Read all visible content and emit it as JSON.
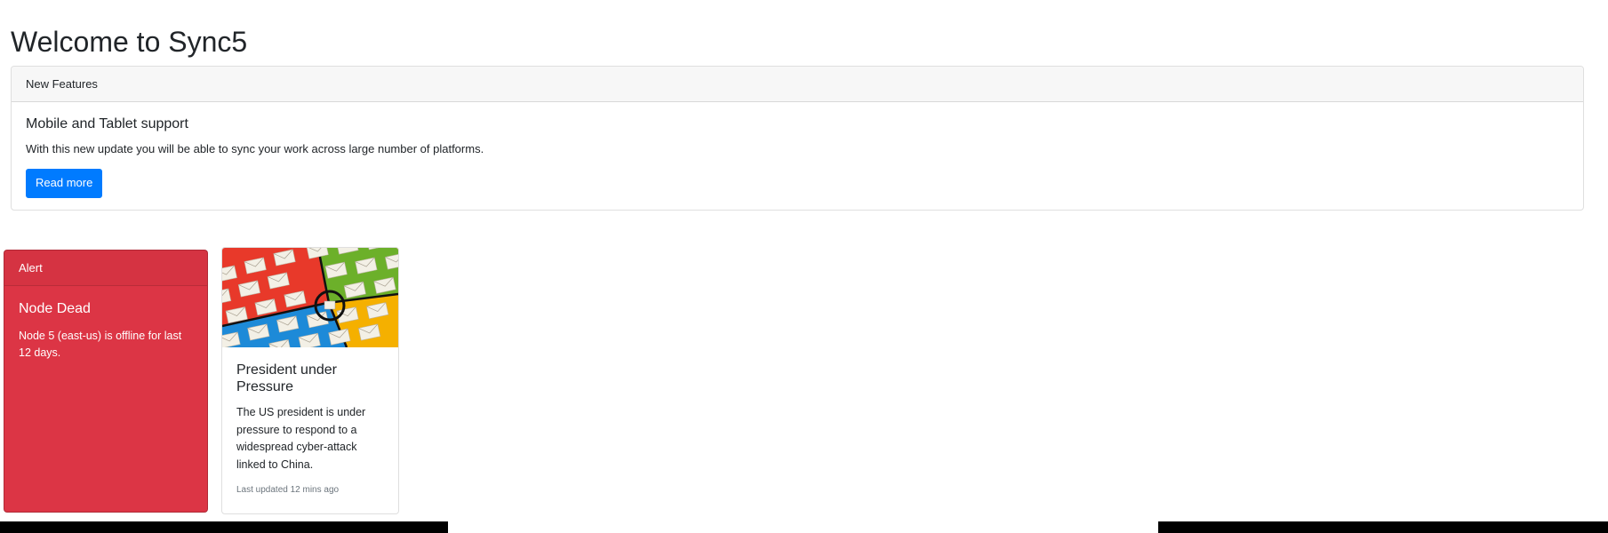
{
  "page": {
    "title": "Welcome to Sync5"
  },
  "feature_card": {
    "header": "New Features",
    "title": "Mobile and Tablet support",
    "text": "With this new update you will be able to sync your work across large number of platforms.",
    "button_label": "Read more",
    "button_color": "#007bff"
  },
  "alert_card": {
    "header": "Alert",
    "title": "Node Dead",
    "text": "Node 5 (east-us) is offline for last 12 days.",
    "background_color": "#dc3545"
  },
  "news_card": {
    "image_icon": "envelope-pattern-image",
    "title": "President under Pressure",
    "text": "The US president is under pressure to respond to a widespread cyber-attack linked to China.",
    "updated": "Last updated 12 mins ago"
  }
}
